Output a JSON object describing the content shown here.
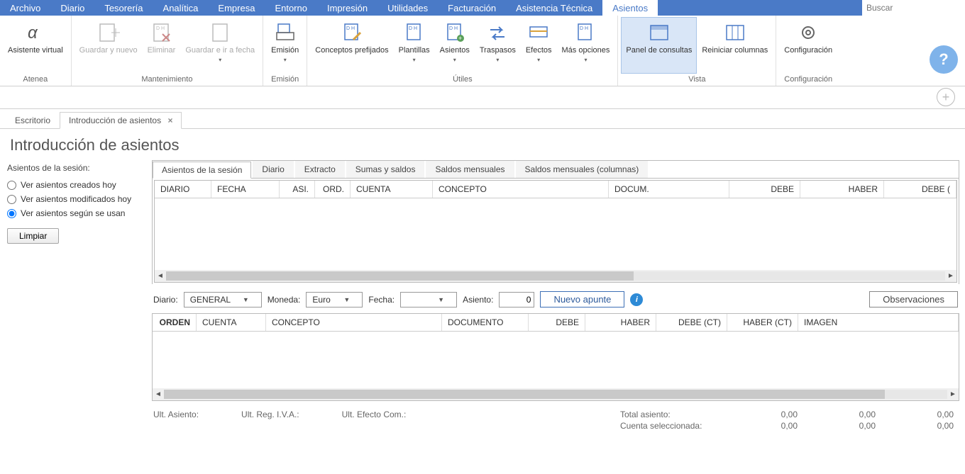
{
  "menubar": {
    "items": [
      "Archivo",
      "Diario",
      "Tesorería",
      "Analítica",
      "Empresa",
      "Entorno",
      "Impresión",
      "Utilidades",
      "Facturación",
      "Asistencia Técnica",
      "Asientos"
    ],
    "active_index": 10,
    "search_placeholder": "Buscar"
  },
  "ribbon": {
    "groups": [
      {
        "label": "Atenea",
        "buttons": [
          {
            "name": "asistente-virtual",
            "label": "Asistente virtual"
          }
        ]
      },
      {
        "label": "Mantenimiento",
        "buttons": [
          {
            "name": "guardar-nuevo",
            "label": "Guardar y nuevo",
            "disabled": true
          },
          {
            "name": "eliminar",
            "label": "Eliminar",
            "disabled": true
          },
          {
            "name": "guardar-ir-fecha",
            "label": "Guardar e ir a fecha",
            "disabled": true,
            "caret": true
          }
        ]
      },
      {
        "label": "Emisión",
        "buttons": [
          {
            "name": "emision",
            "label": "Emisión",
            "caret": true
          }
        ]
      },
      {
        "label": "Útiles",
        "buttons": [
          {
            "name": "conceptos-prefijados",
            "label": "Conceptos prefijados"
          },
          {
            "name": "plantillas",
            "label": "Plantillas",
            "caret": true
          },
          {
            "name": "asientos",
            "label": "Asientos",
            "caret": true
          },
          {
            "name": "traspasos",
            "label": "Traspasos",
            "caret": true
          },
          {
            "name": "efectos",
            "label": "Efectos",
            "caret": true
          },
          {
            "name": "mas-opciones",
            "label": "Más opciones",
            "caret": true
          }
        ]
      },
      {
        "label": "Vista",
        "buttons": [
          {
            "name": "panel-consultas",
            "label": "Panel de consultas",
            "active": true
          },
          {
            "name": "reiniciar-columnas",
            "label": "Reiniciar columnas"
          }
        ]
      },
      {
        "label": "Configuración",
        "buttons": [
          {
            "name": "configuracion",
            "label": "Configuración"
          }
        ]
      }
    ]
  },
  "doctabs": {
    "items": [
      {
        "label": "Escritorio",
        "closable": false
      },
      {
        "label": "Introducción de asientos",
        "closable": true,
        "active": true
      }
    ]
  },
  "page_title": "Introducción de asientos",
  "sidebar": {
    "title": "Asientos de la sesión:",
    "options": [
      {
        "label": "Ver asientos creados hoy"
      },
      {
        "label": "Ver asientos modificados hoy"
      },
      {
        "label": "Ver asientos según se usan",
        "checked": true
      }
    ],
    "clear_button": "Limpiar"
  },
  "inner_tabs": [
    "Asientos de la sesión",
    "Diario",
    "Extracto",
    "Sumas y saldos",
    "Saldos mensuales",
    "Saldos mensuales (columnas)"
  ],
  "inner_tabs_active": 0,
  "grid1_headers": [
    "DIARIO",
    "FECHA",
    "ASI.",
    "ORD.",
    "CUENTA",
    "CONCEPTO",
    "DOCUM.",
    "DEBE",
    "HABER",
    "DEBE ("
  ],
  "formrow": {
    "diario_label": "Diario:",
    "diario_value": "GENERAL",
    "moneda_label": "Moneda:",
    "moneda_value": "Euro",
    "fecha_label": "Fecha:",
    "fecha_value": "",
    "asiento_label": "Asiento:",
    "asiento_value": "0",
    "nuevo_apunte": "Nuevo apunte",
    "observaciones": "Observaciones"
  },
  "grid2_headers": [
    "ORDEN",
    "CUENTA",
    "CONCEPTO",
    "DOCUMENTO",
    "DEBE",
    "HABER",
    "DEBE (CT)",
    "HABER (CT)",
    "IMAGEN"
  ],
  "footer": {
    "ult_asiento": "Ult. Asiento:",
    "ult_reg_iva": "Ult. Reg. I.V.A.:",
    "ult_efecto": "Ult. Efecto Com.:",
    "total_asiento_label": "Total asiento:",
    "cuenta_sel_label": "Cuenta seleccionada:",
    "vals": [
      "0,00",
      "0,00",
      "0,00",
      "0,00",
      "0,00",
      "0,00"
    ]
  }
}
